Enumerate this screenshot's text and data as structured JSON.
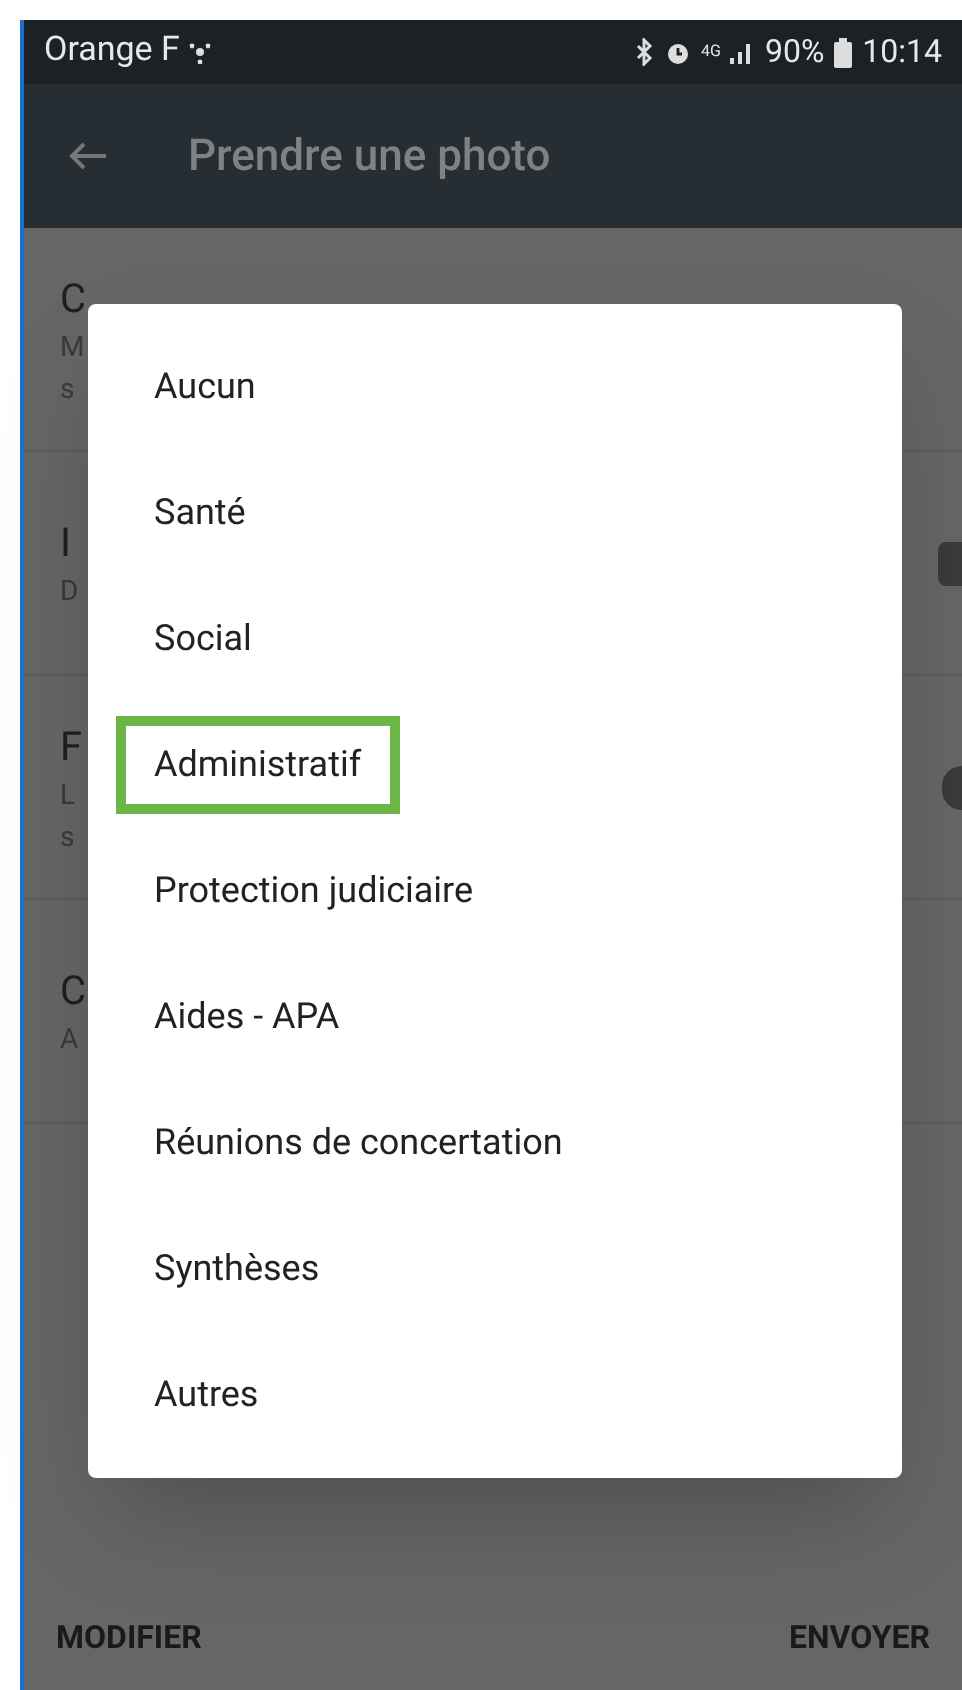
{
  "status_bar": {
    "carrier": "Orange F",
    "network": "4G",
    "battery": "90%",
    "time": "10:14"
  },
  "app_bar": {
    "title": "Prendre une photo"
  },
  "settings": [
    {
      "title": "C",
      "lines": [
        "M",
        "s"
      ],
      "kind": "plain"
    },
    {
      "title": "I",
      "lines": [
        "D"
      ],
      "kind": "switch"
    },
    {
      "title": "F",
      "lines": [
        "L",
        "s"
      ],
      "kind": "radio"
    },
    {
      "title": "C",
      "lines": [
        "A"
      ],
      "kind": "plain"
    }
  ],
  "dialog": {
    "options": [
      {
        "label": "Aucun",
        "highlighted": false
      },
      {
        "label": "Santé",
        "highlighted": false
      },
      {
        "label": "Social",
        "highlighted": false
      },
      {
        "label": "Administratif",
        "highlighted": true
      },
      {
        "label": "Protection judiciaire",
        "highlighted": false
      },
      {
        "label": "Aides - APA",
        "highlighted": false
      },
      {
        "label": "Réunions de concertation",
        "highlighted": false
      },
      {
        "label": "Synthèses",
        "highlighted": false
      },
      {
        "label": "Autres",
        "highlighted": false
      }
    ]
  },
  "actions": [
    "MODIFIER",
    "ENVOYER"
  ]
}
